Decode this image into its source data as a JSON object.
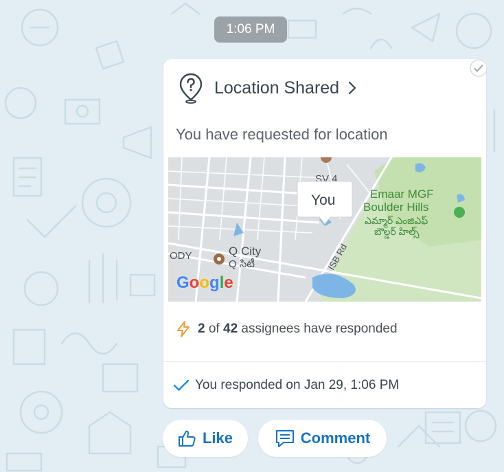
{
  "time": "1:06 PM",
  "card": {
    "title": "Location Shared",
    "subtitle": "You have requested for location",
    "map": {
      "marker_label": "You",
      "places": {
        "emaar_line1": "Emaar MGF",
        "emaar_line2": "Boulder Hills",
        "emaar_te1": "ఎమ్మార్ ఎంజిఎఫ్",
        "emaar_te2": "బౌల్డర్ హిల్స్",
        "qcity": "Q City",
        "qcity_te": "Q సిటీ",
        "road": "ISB Rd",
        "sv": "SV 4",
        "ody": "ODY"
      },
      "logo": "Google"
    },
    "stats": {
      "responded": "2",
      "of": "of",
      "total": "42",
      "suffix": "assignees have responded"
    },
    "responded_text": "You responded on Jan 29, 1:06 PM"
  },
  "actions": {
    "like": "Like",
    "comment": "Comment"
  },
  "colors": {
    "accent": "#1873c8",
    "bolt": "#f39c3d",
    "park": "#c8e6b4",
    "water": "#7bb8e8"
  }
}
